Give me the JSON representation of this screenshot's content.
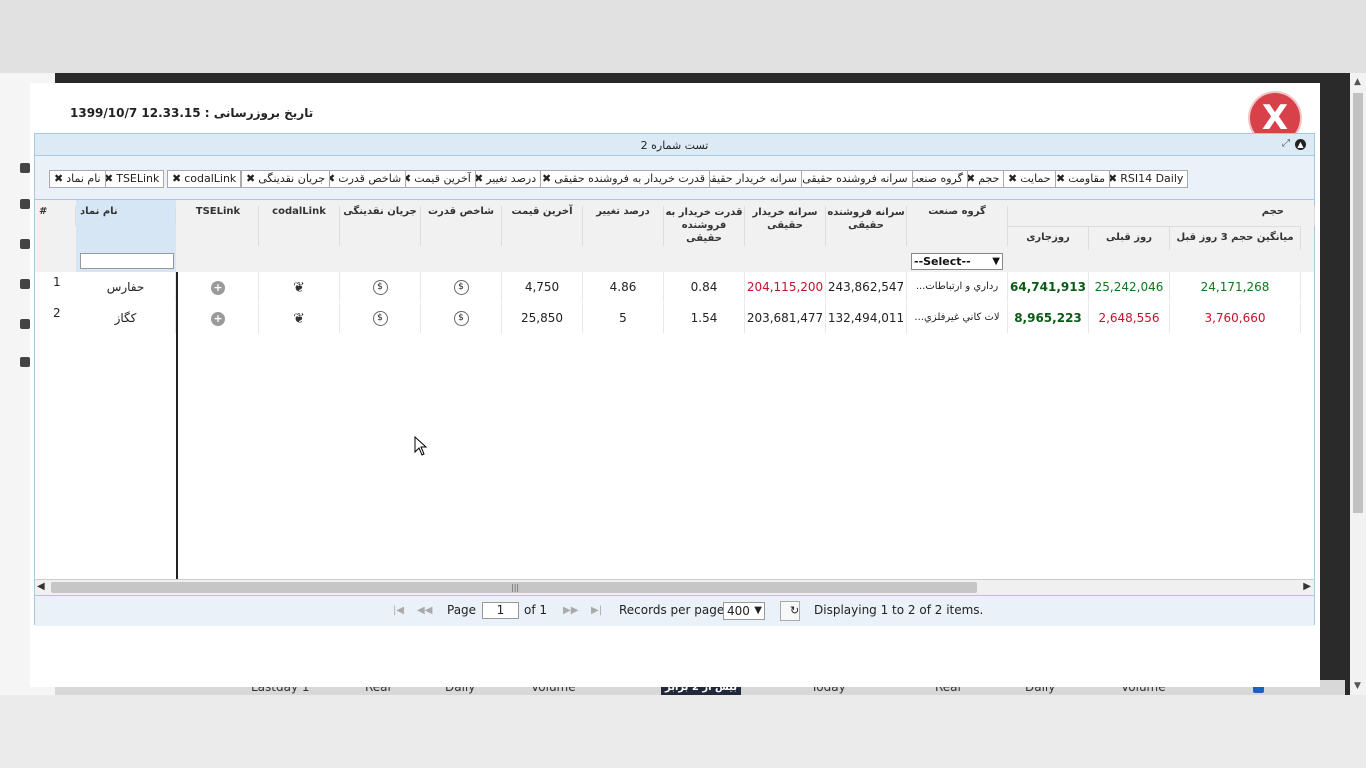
{
  "update": {
    "label": "تاریخ بروزرسانی : 12.33.15 1399/10/7"
  },
  "close": {
    "label": "X"
  },
  "grid": {
    "title": "تست شماره 2"
  },
  "chips": [
    {
      "label": "RSI14 Daily"
    },
    {
      "label": "مقاومت"
    },
    {
      "label": "حمایت"
    },
    {
      "label": "حجم"
    },
    {
      "label": "گروه صنعت"
    },
    {
      "label": "سرانه فروشنده حقیقی"
    },
    {
      "label": "سرانه خریدار حقیقی"
    },
    {
      "label": "قدرت خریدار به فروشنده حقیقی"
    },
    {
      "label": "درصد تغییر"
    },
    {
      "label": "آخرین قیمت"
    },
    {
      "label": "شاخص قدرت"
    },
    {
      "label": "جریان نقدینگی"
    },
    {
      "label": "codalLink"
    },
    {
      "label": "TSELink"
    },
    {
      "label": "نام نماد"
    }
  ],
  "headers": {
    "num": "#",
    "name": "نام نماد",
    "tselink": "TSELink",
    "codallink": "codalLink",
    "flow": "جریان نقدینگی",
    "power_index": "شاخص قدرت",
    "last_price": "آخرین قیمت",
    "change_pct": "درصد تغییر",
    "buyer_power": "قدرت خریدار به فروشنده حقیقی",
    "buyer_per_capita": "سرانه خریدار حقیقی",
    "seller_per_capita": "سرانه فروشنده حقیقی",
    "industry": "گروه صنعت",
    "volume": "حجم",
    "today": "روزجاری",
    "prev_day": "روز قبلی",
    "avg3": "میانگین حجم 3 روز قبل"
  },
  "filter": {
    "industry_select": "--Select--"
  },
  "rows": [
    {
      "num": "1",
      "name": "حفارس",
      "last_price": "4,750",
      "change_pct": "4.86",
      "buyer_power": "0.84",
      "buyer_per_capita": "204,115,200",
      "seller_per_capita": "243,862,547",
      "industry": "...رداري و ارتباطات",
      "today": "64,741,913",
      "prev_day": "25,242,046",
      "avg3": "24,171,268"
    },
    {
      "num": "2",
      "name": "کگاز",
      "last_price": "25,850",
      "change_pct": "5",
      "buyer_power": "1.54",
      "buyer_per_capita": "203,681,477",
      "seller_per_capita": "132,494,011",
      "industry": "...لات كاني غيرفلزي",
      "today": "8,965,223",
      "prev_day": "2,648,556",
      "avg3": "3,760,660"
    }
  ],
  "icons": {
    "plus": "+",
    "wave": "❦",
    "dollar": "$"
  },
  "pager": {
    "page_label": "Page",
    "page_value": "1",
    "of_label": "of 1",
    "records_label": "Records per page:",
    "records_value": "400",
    "display": "Displaying 1 to 2 of 2 items."
  },
  "background_bar": {
    "items": [
      "Lastday 1",
      "Real",
      "Daily",
      "Volume",
      "بیش از 2 برابر",
      "Today",
      "Real",
      "Daily",
      "Volume"
    ]
  },
  "colors": {
    "red": "#c8102e",
    "green": "#0a7a1b",
    "header_bg": "#dceaf6",
    "close_red": "#d9414a"
  }
}
